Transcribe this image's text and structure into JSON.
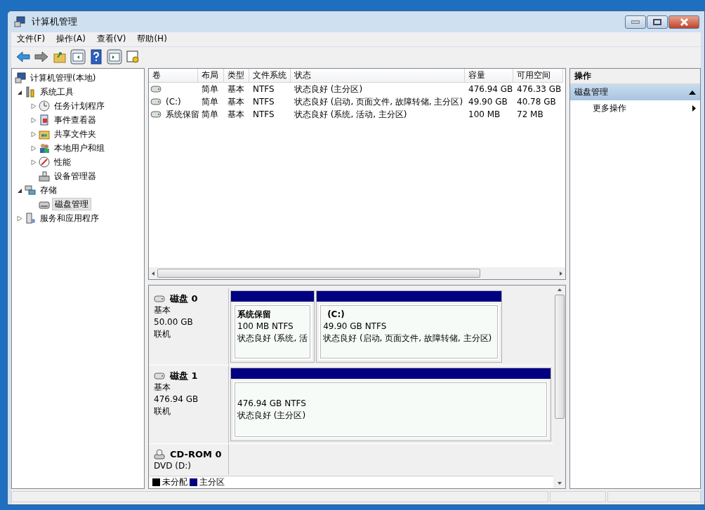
{
  "window": {
    "title": "计算机管理"
  },
  "menu": [
    "文件(F)",
    "操作(A)",
    "查看(V)",
    "帮助(H)"
  ],
  "tree": {
    "label": "计算机管理(本地)",
    "selected": false,
    "children": [
      {
        "label": "系统工具",
        "expanded": true,
        "selected": false,
        "children": [
          {
            "label": "任务计划程序",
            "expanded": false,
            "selected": false
          },
          {
            "label": "事件查看器",
            "expanded": false,
            "selected": false
          },
          {
            "label": "共享文件夹",
            "expanded": false,
            "selected": false
          },
          {
            "label": "本地用户和组",
            "expanded": false,
            "selected": false
          },
          {
            "label": "性能",
            "expanded": false,
            "selected": false
          },
          {
            "label": "设备管理器",
            "selected": false
          }
        ]
      },
      {
        "label": "存储",
        "expanded": true,
        "selected": false,
        "children": [
          {
            "label": "磁盘管理",
            "selected": true
          }
        ]
      },
      {
        "label": "服务和应用程序",
        "expanded": false,
        "selected": false
      }
    ]
  },
  "volumes": {
    "columns": [
      "卷",
      "布局",
      "类型",
      "文件系统",
      "状态",
      "容量",
      "可用空间"
    ],
    "rows": [
      [
        "",
        "简单",
        "基本",
        "NTFS",
        "状态良好 (主分区)",
        "476.94 GB",
        "476.33 GB"
      ],
      [
        "(C:)",
        "简单",
        "基本",
        "NTFS",
        "状态良好 (启动, 页面文件, 故障转储, 主分区)",
        "49.90 GB",
        "40.78 GB"
      ],
      [
        "系统保留",
        "简单",
        "基本",
        "NTFS",
        "状态良好 (系统, 活动, 主分区)",
        "100 MB",
        "72 MB"
      ]
    ]
  },
  "disks": [
    {
      "kind": "disk",
      "name": "磁盘 0",
      "type": "基本",
      "size": "50.00 GB",
      "status": "联机",
      "partitions": [
        {
          "label": "系统保留",
          "size": "100 MB NTFS",
          "status": "状态良好 (系统, 活"
        },
        {
          "label": "(C:)",
          "size": "49.90 GB NTFS",
          "status": "状态良好 (启动, 页面文件, 故障转储, 主分区)"
        }
      ]
    },
    {
      "kind": "disk",
      "name": "磁盘 1",
      "type": "基本",
      "size": "476.94 GB",
      "status": "联机",
      "partitions": [
        {
          "size": "476.94 GB NTFS",
          "status": "状态良好 (主分区)"
        }
      ]
    },
    {
      "kind": "cdrom",
      "name": "CD-ROM 0",
      "type": "DVD (D:)"
    }
  ],
  "legend": [
    {
      "label": "未分配",
      "color": "#000000"
    },
    {
      "label": "主分区",
      "color": "#000080"
    }
  ],
  "actions": {
    "header": "操作",
    "sections": [
      {
        "title": "磁盘管理",
        "expanded": true,
        "items": [
          "更多操作"
        ]
      }
    ]
  }
}
